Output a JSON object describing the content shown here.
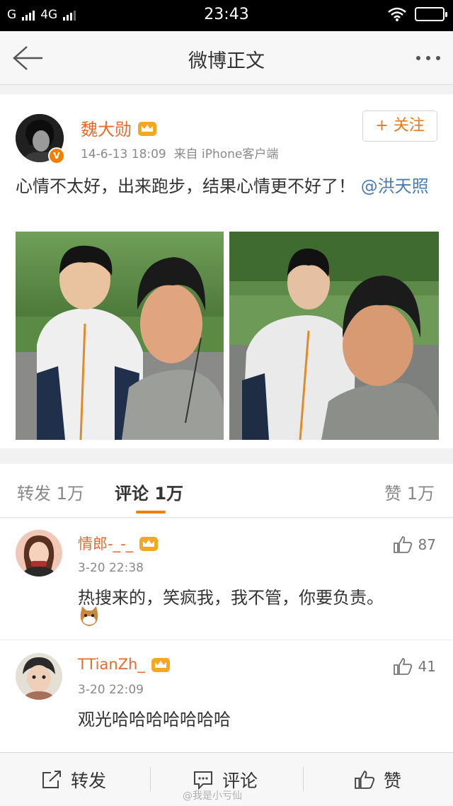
{
  "status_bar": {
    "carrier": "G",
    "network": "4G",
    "time": "23:43"
  },
  "nav": {
    "title": "微博正文"
  },
  "post": {
    "author": "魏大勋",
    "verified_mark": "V",
    "timestamp": "14-6-13 18:09",
    "source": "来自 iPhone客户端",
    "follow_label": "+ 关注",
    "text": "心情不太好，出来跑步，结果心情更不好了！",
    "mention": "@洪天照",
    "accent_color": "#e86b2e",
    "link_color": "#4a7dac"
  },
  "tabs": {
    "repost": "转发",
    "repost_count": "1万",
    "comment": "评论",
    "comment_count": "1万",
    "like": "赞",
    "like_count": "1万",
    "active_color": "#f08000"
  },
  "comments": [
    {
      "name": "情郎-_-_",
      "time": "3-20 22:38",
      "text": "热搜来的，笑疯我，我不管，你要负责。",
      "likes": "87"
    },
    {
      "name": "TTianZh_",
      "time": "3-20 22:09",
      "text": "观光哈哈哈哈哈哈哈",
      "likes": "41"
    }
  ],
  "toolbar": {
    "repost_label": "转发",
    "comment_label": "评论",
    "like_label": "赞"
  },
  "watermark": "@我是小亏仙"
}
